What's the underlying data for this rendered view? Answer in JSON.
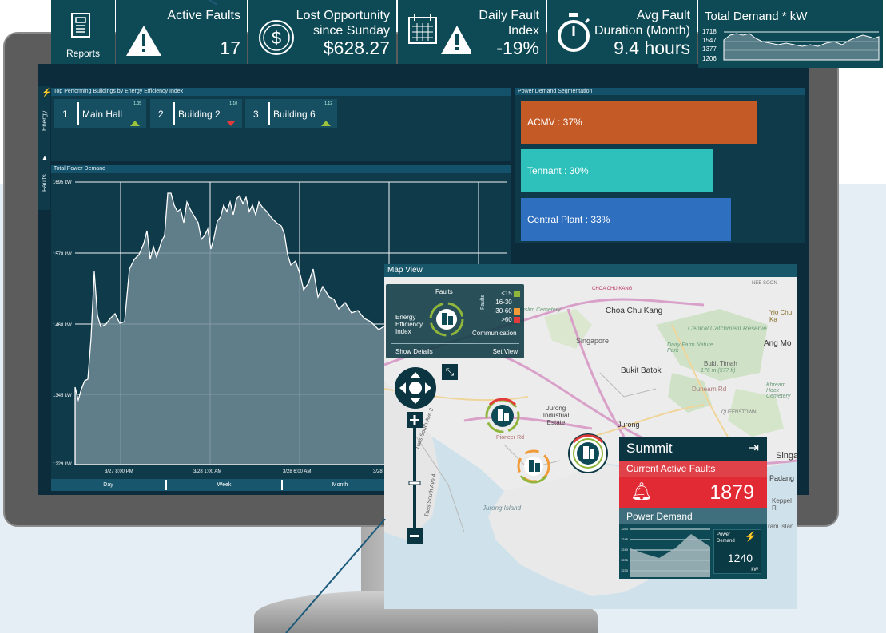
{
  "kpis": {
    "reports": {
      "label": "Reports",
      "icon": "report-document-icon"
    },
    "active_faults": {
      "label": "Active Faults",
      "value": "17",
      "icon": "warning-icon"
    },
    "lost_opportunity": {
      "label_line1": "Lost Opportunity",
      "label_line2": "since Sunday",
      "value": "$628.27",
      "icon": "dollar-coin-icon"
    },
    "daily_fault_index": {
      "label_line1": "Daily Fault",
      "label_line2": "Index",
      "value": "-19%",
      "icon": "calendar-warning-icon"
    },
    "avg_fault_duration": {
      "label_line1": "Avg Fault",
      "label_line2": "Duration (Month)",
      "value": "9.4 hours",
      "icon": "stopwatch-icon"
    },
    "total_demand": {
      "label": "Total Demand * kW",
      "ticks": [
        "1718",
        "1547",
        "1377",
        "1206"
      ]
    }
  },
  "left_rail": {
    "energy_label": "Energy",
    "faults_label": "Faults"
  },
  "buildings": {
    "title": "Top Performing Buildings by Energy Efficiency Index",
    "items": [
      {
        "rank": "1",
        "name": "Main Hall",
        "value": "1.05",
        "trend": "up"
      },
      {
        "rank": "2",
        "name": "Building 2",
        "value": "1.10",
        "trend": "down"
      },
      {
        "rank": "3",
        "name": "Building 6",
        "value": "1.12",
        "trend": "up"
      }
    ]
  },
  "segmentation": {
    "title": "Power Demand Segmentation",
    "segments": [
      {
        "label": "ACMV : 37%",
        "color": "#c45a26"
      },
      {
        "label": "Tennant : 30%",
        "color": "#2ec1bc"
      },
      {
        "label": "Central Plant : 33%",
        "color": "#2f6fbf"
      }
    ]
  },
  "total_power": {
    "title": "Total Power Demand",
    "y_ticks": [
      "1695 kW",
      "1578 kW",
      "1468 kW",
      "1345 kW",
      "1229 kW"
    ],
    "x_ticks": [
      "3/27 8:00 PM",
      "3/28 1:00 AM",
      "3/28 6:00 AM",
      "3/28"
    ],
    "tabs": [
      "Day",
      "Week",
      "Month"
    ]
  },
  "map": {
    "title": "Map View",
    "legend": {
      "faults": "Faults",
      "energy_line1": "Energy",
      "energy_line2": "Efficiency",
      "energy_line3": "Index",
      "communication": "Communication",
      "faults_vertical": "Faults",
      "ranges": [
        {
          "label": "<15",
          "color": "#8fb63a"
        },
        {
          "label": "16-30",
          "color": "#0e4a55"
        },
        {
          "label": "30-60",
          "color": "#f29a38"
        },
        {
          "label": ">60",
          "color": "#e23b3b"
        }
      ],
      "show_details": "Show Details",
      "set_view": "Set View"
    },
    "labels": {
      "choa_chu_kang": "Choa Chu Kang",
      "singapore": "Singapore",
      "muslim_cemetery": "Muslim Cemetery",
      "central_reserve": "Central Catchment Reserve",
      "ang_mo": "Ang Mo",
      "dairy_farm": "Dairy Farm Nature Park",
      "bukit_batok": "Bukit Batok",
      "bukit_timah": "Bukit Timah",
      "bukit_timah_height": "176 m (577 ft)",
      "dunearn": "Dunearn Rd",
      "khream": "Khream Hock Cemetery",
      "jurong_industrial": "Jurong Industrial Estate",
      "jurong": "Jurong",
      "pioneer_rd": "Pioneer Rd",
      "tuas_south": "Tuas South Ave 3",
      "tuas_south2": "Tuas South Ave 4",
      "jurong_island": "Jurong Island",
      "singa": "Singa",
      "padang": "Padang",
      "keppel": "Keppel R",
      "sani_island": "rani Islan",
      "queenstown": "QUEENSTOWN",
      "choa_chu_kang_road": "CHOA CHU KANG",
      "nee_soon": "NEE SOON",
      "yio_chu": "Yio Chu Ka"
    }
  },
  "summit": {
    "title": "Summit",
    "fault_label": "Current Active Faults",
    "fault_value": "1879",
    "pd_label": "Power Demand",
    "pd_ticks": [
      "1250",
      "1245",
      "1240",
      "1235",
      "1230"
    ],
    "pd_box_line1": "Power",
    "pd_box_line2": "Demand",
    "pd_value": "1240",
    "pd_unit": "kW"
  }
}
